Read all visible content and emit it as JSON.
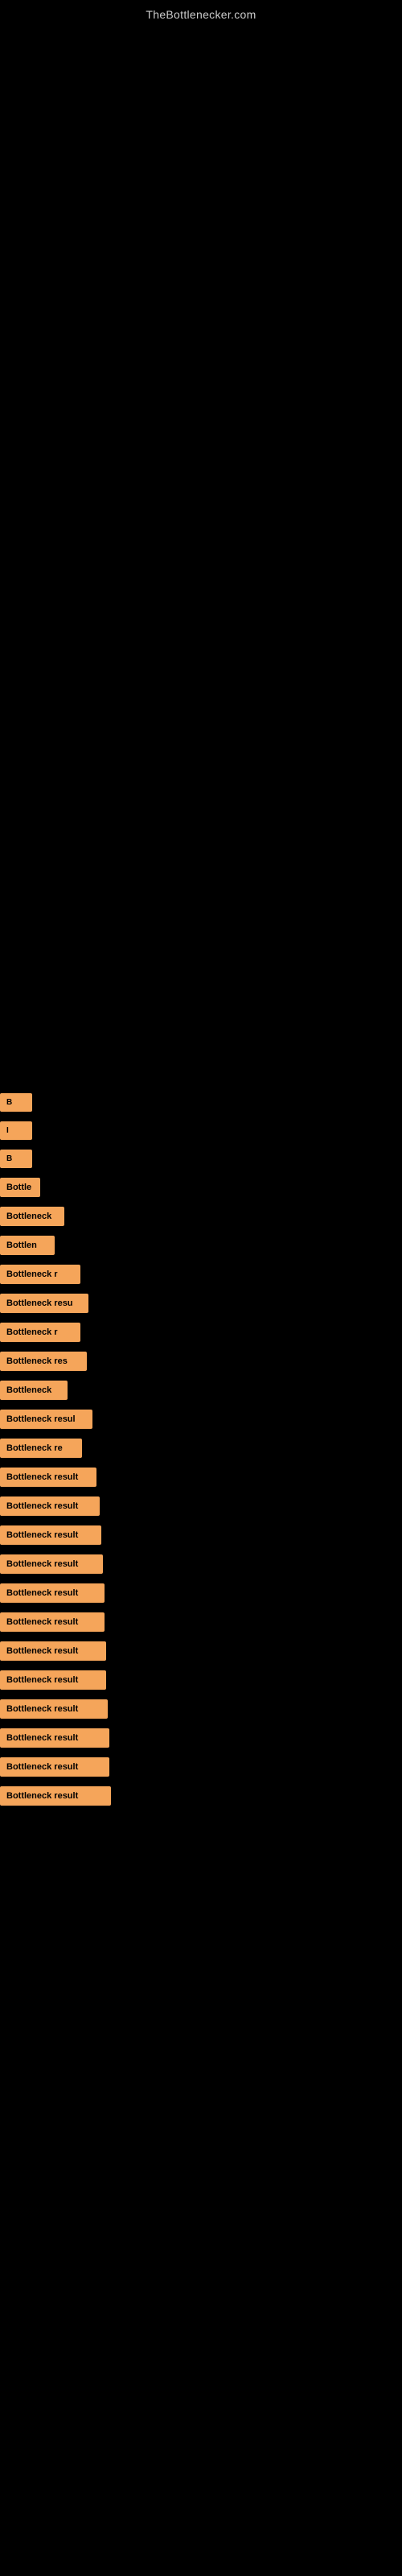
{
  "site": {
    "title": "TheBottlenecker.com"
  },
  "results": [
    {
      "id": 1,
      "label": "B",
      "badgeClass": "badge-w1"
    },
    {
      "id": 2,
      "label": "I",
      "badgeClass": "badge-w2"
    },
    {
      "id": 3,
      "label": "B",
      "badgeClass": "badge-w3"
    },
    {
      "id": 4,
      "label": "Bottle",
      "badgeClass": "badge-w4"
    },
    {
      "id": 5,
      "label": "Bottleneck",
      "badgeClass": "badge-w5"
    },
    {
      "id": 6,
      "label": "Bottlen",
      "badgeClass": "badge-w6"
    },
    {
      "id": 7,
      "label": "Bottleneck r",
      "badgeClass": "badge-w7"
    },
    {
      "id": 8,
      "label": "Bottleneck resu",
      "badgeClass": "badge-w8"
    },
    {
      "id": 9,
      "label": "Bottleneck r",
      "badgeClass": "badge-w9"
    },
    {
      "id": 10,
      "label": "Bottleneck res",
      "badgeClass": "badge-w10"
    },
    {
      "id": 11,
      "label": "Bottleneck",
      "badgeClass": "badge-w11"
    },
    {
      "id": 12,
      "label": "Bottleneck resul",
      "badgeClass": "badge-w12"
    },
    {
      "id": 13,
      "label": "Bottleneck re",
      "badgeClass": "badge-w13"
    },
    {
      "id": 14,
      "label": "Bottleneck result",
      "badgeClass": "badge-w14"
    },
    {
      "id": 15,
      "label": "Bottleneck result",
      "badgeClass": "badge-w15"
    },
    {
      "id": 16,
      "label": "Bottleneck result",
      "badgeClass": "badge-w16"
    },
    {
      "id": 17,
      "label": "Bottleneck result",
      "badgeClass": "badge-w17"
    },
    {
      "id": 18,
      "label": "Bottleneck result",
      "badgeClass": "badge-w18"
    },
    {
      "id": 19,
      "label": "Bottleneck result",
      "badgeClass": "badge-w19"
    },
    {
      "id": 20,
      "label": "Bottleneck result",
      "badgeClass": "badge-w20"
    },
    {
      "id": 21,
      "label": "Bottleneck result",
      "badgeClass": "badge-w21"
    },
    {
      "id": 22,
      "label": "Bottleneck result",
      "badgeClass": "badge-w22"
    },
    {
      "id": 23,
      "label": "Bottleneck result",
      "badgeClass": "badge-w23"
    },
    {
      "id": 24,
      "label": "Bottleneck result",
      "badgeClass": "badge-w24"
    },
    {
      "id": 25,
      "label": "Bottleneck result",
      "badgeClass": "badge-w25"
    }
  ]
}
